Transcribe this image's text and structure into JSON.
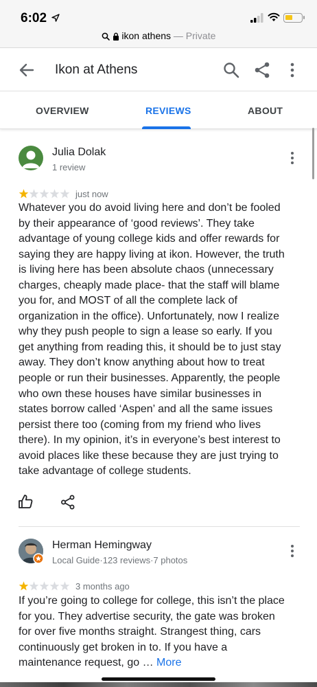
{
  "status_bar": {
    "time": "6:02"
  },
  "url_bar": {
    "domain": "ikon athens",
    "separator": " — ",
    "mode": "Private"
  },
  "header": {
    "title": "Ikon at Athens"
  },
  "tabs": [
    {
      "label": "OVERVIEW",
      "active": false
    },
    {
      "label": "REVIEWS",
      "active": true
    },
    {
      "label": "ABOUT",
      "active": false
    }
  ],
  "reviews": [
    {
      "name": "Julia Dolak",
      "meta": "1 review",
      "rating": 1,
      "time": "just now",
      "text": "Whatever you do avoid living here and don’t be fooled by their appearance of ‘good reviews’. They take advantage of young college kids and offer rewards for saying they are happy living at ikon. However, the truth is living here has been absolute chaos (unnecessary charges, cheaply made place- that the staff will blame you for, and MOST of all the complete lack of organization in the office). Unfortunately, now I realize why they push people to sign a lease so early. If you get anything from reading this, it should be to just stay away. They don’t know anything about how to treat people or run their businesses. Apparently, the people who own these houses have similar businesses in states borrow called ‘Aspen’ and all the same issues persist there too (coming from my friend who lives there). In my opinion, it’s in everyone’s best interest to avoid places like these because they are just trying to take advantage of college students."
    },
    {
      "name": "Herman Hemingway",
      "meta": "Local Guide·123 reviews·7 photos",
      "rating": 1,
      "time": "3 months ago",
      "text": "If you’re going to college for college, this isn’t the place for you. They advertise security, the gate was broken for over five months straight. Strangest thing, cars continuously get broken in to. If you have a maintenance request, go …",
      "more_label": "More"
    }
  ],
  "colors": {
    "accent": "#1a73e8",
    "star_filled": "#f4b400",
    "star_empty": "#dadce0"
  }
}
